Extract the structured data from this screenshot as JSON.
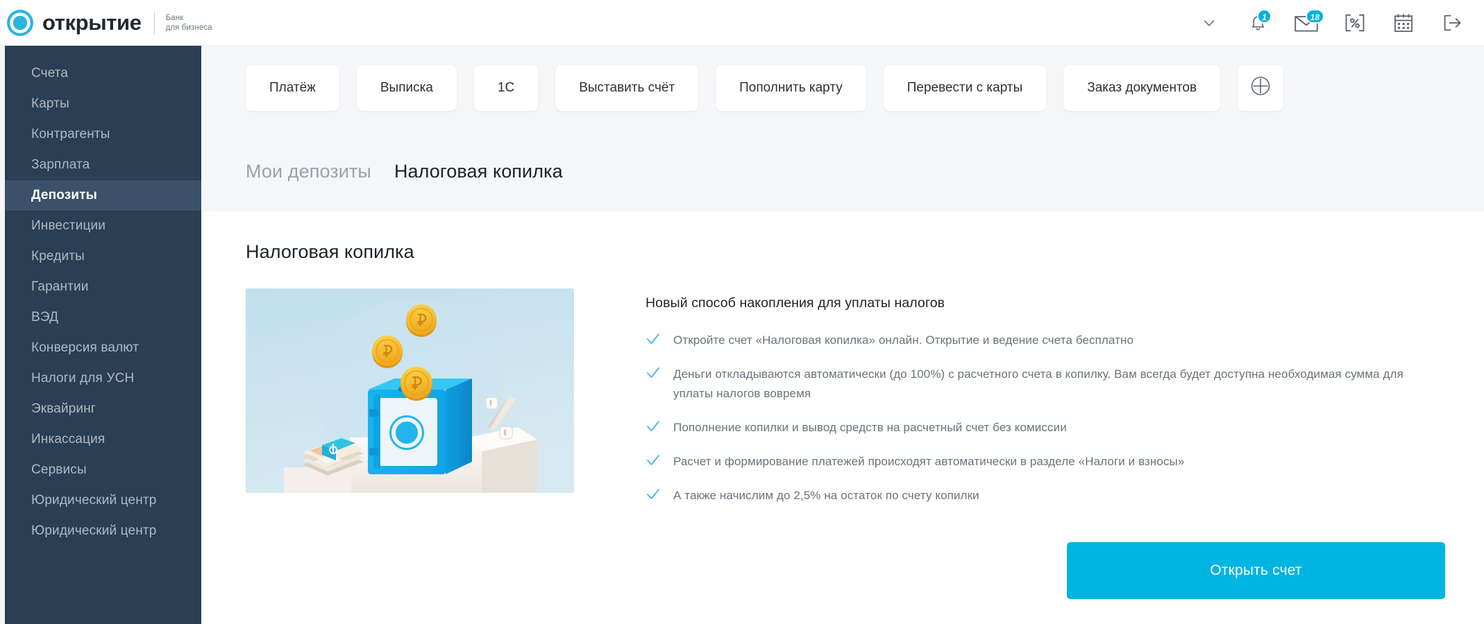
{
  "brand": {
    "word": "открытие",
    "sub_line1": "Банк",
    "sub_line2": "для бизнеса",
    "logo_icon": "otkritie-logo-icon",
    "accent": "#00b5e2"
  },
  "topbar": {
    "profile_chevron_icon": "chevron-down-icon",
    "icons": [
      {
        "name": "bell-icon",
        "badge": "1"
      },
      {
        "name": "mail-icon",
        "badge": "18"
      },
      {
        "name": "percent-icon",
        "badge": ""
      },
      {
        "name": "calendar-icon",
        "badge": ""
      },
      {
        "name": "logout-icon",
        "badge": ""
      }
    ]
  },
  "sidebar": {
    "items": [
      {
        "label": "Счета",
        "active": false
      },
      {
        "label": "Карты",
        "active": false
      },
      {
        "label": "Контрагенты",
        "active": false
      },
      {
        "label": "Зарплата",
        "active": false
      },
      {
        "label": "Депозиты",
        "active": true
      },
      {
        "label": "Инвестиции",
        "active": false
      },
      {
        "label": "Кредиты",
        "active": false
      },
      {
        "label": "Гарантии",
        "active": false
      },
      {
        "label": "ВЭД",
        "active": false
      },
      {
        "label": "Конверсия валют",
        "active": false
      },
      {
        "label": "Налоги для УСН",
        "active": false
      },
      {
        "label": "Эквайринг",
        "active": false
      },
      {
        "label": "Инкассация",
        "active": false
      },
      {
        "label": "Сервисы",
        "active": false
      },
      {
        "label": "Юридический центр",
        "active": false
      },
      {
        "label": "Юридический центр",
        "active": false
      }
    ]
  },
  "quick_actions": {
    "buttons": [
      {
        "label": "Платёж"
      },
      {
        "label": "Выписка"
      },
      {
        "label": "1C"
      },
      {
        "label": "Выставить счёт"
      },
      {
        "label": "Пополнить карту"
      },
      {
        "label": "Перевести с карты"
      },
      {
        "label": "Заказ документов"
      }
    ],
    "add_button_icon": "plus-circle-icon"
  },
  "tabs": [
    {
      "label": "Мои депозиты",
      "active": false
    },
    {
      "label": "Налоговая копилка",
      "active": true
    }
  ],
  "card": {
    "title": "Налоговая копилка",
    "illustration_name": "tax-piggy-bank-safe-illustration",
    "info_title": "Новый способ накопления для уплаты налогов",
    "bullets": [
      "Откройте счет «Налоговая копилка» онлайн. Открытие и ведение счета бесплатно",
      "Деньги откладываются автоматически (до 100%) с расчетного счета в копилку. Вам всегда будет доступна необходимая сумма для уплаты налогов вовремя",
      "Пополнение копилки и вывод средств на расчетный счет без комиссии",
      "Расчет и формирование платежей происходят автоматически в разделе «Налоги и взносы»",
      "А также начислим до 2,5% на остаток по счету копилки"
    ],
    "check_icon": "check-icon",
    "cta_label": "Открыть счет"
  }
}
